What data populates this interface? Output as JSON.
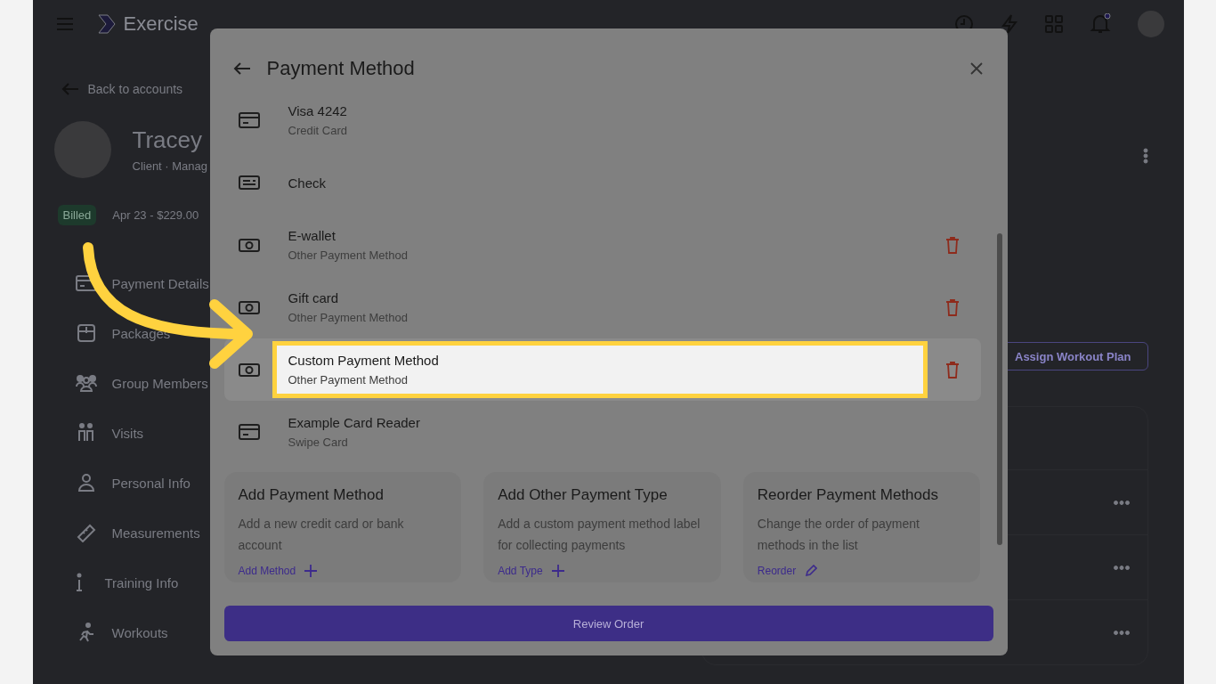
{
  "app_bar": {
    "logo": "Exercise",
    "notification_dot": true
  },
  "back_link": "Back to accounts",
  "profile": {
    "name": "Tracey",
    "subtitle": "Client · Manag",
    "badge": "Billed",
    "billing": "Apr 23 - $229.00"
  },
  "sidebar": {
    "items": [
      {
        "label": "Payment Details"
      },
      {
        "label": "Packages"
      },
      {
        "label": "Group Members"
      },
      {
        "label": "Visits"
      },
      {
        "label": "Personal Info"
      },
      {
        "label": "Measurements"
      },
      {
        "label": "Training Info"
      },
      {
        "label": "Workouts"
      }
    ]
  },
  "assign_button": "Assign Workout Plan",
  "modal": {
    "title": "Payment Method",
    "rows": [
      {
        "title": "Visa 4242",
        "subtitle": "Credit Card",
        "kind": "card",
        "deletable": false,
        "highlighted": false
      },
      {
        "title": "Check",
        "kind": "check",
        "deletable": false,
        "highlighted": false
      },
      {
        "title": "E-wallet",
        "subtitle": "Other Payment Method",
        "kind": "cash",
        "deletable": true,
        "highlighted": false
      },
      {
        "title": "Gift card",
        "subtitle": "Other Payment Method",
        "kind": "cash",
        "deletable": true,
        "highlighted": false
      },
      {
        "title": "Custom Payment Method",
        "subtitle": "Other Payment Method",
        "kind": "cash",
        "deletable": true,
        "highlighted": true
      },
      {
        "title": "Example Card Reader",
        "subtitle": "Swipe Card",
        "kind": "card",
        "deletable": false,
        "highlighted": false
      }
    ],
    "cards": [
      {
        "title": "Add Payment Method",
        "text": "Add a new credit card or bank account",
        "action": "Add Method"
      },
      {
        "title": "Add Other Payment Type",
        "text": "Add a custom payment method label for collecting payments",
        "action": "Add Type"
      },
      {
        "title": "Reorder Payment Methods",
        "text": "Change the order of payment methods in the list",
        "action": "Reorder"
      }
    ],
    "button": "Review Order"
  }
}
